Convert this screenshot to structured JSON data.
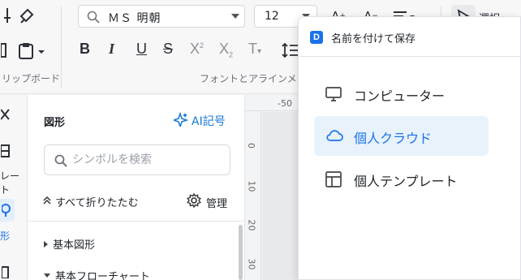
{
  "toolbar": {
    "clipboard_group_label": "リップボード",
    "font_group_label": "フォントとアラインメント",
    "font_family_value": "ＭＳ 明朝",
    "font_size_value": "12",
    "select_label": "選択",
    "format_buttons": [
      "B",
      "I",
      "U",
      "S",
      "X²",
      "X₂",
      "T"
    ]
  },
  "rail": {
    "items": [
      {
        "label": "レート",
        "icon": "template-icon"
      },
      {
        "label": "形",
        "icon": "shapes-icon"
      }
    ]
  },
  "shapes_panel": {
    "title": "図形",
    "ai_label": "AI記号",
    "search_placeholder": "シンボルを検索",
    "collapse_all_label": "すべて折りたたむ",
    "manage_label": "管理",
    "tree": [
      {
        "label": "基本図形",
        "expanded": false
      },
      {
        "label": "基本フローチャート",
        "expanded": true
      }
    ]
  },
  "ruler": {
    "top_numbers": [
      "-50"
    ],
    "left_numbers": [
      "0",
      "10",
      "20",
      "30"
    ]
  },
  "save_menu": {
    "title": "名前を付けて保存",
    "logo_letter": "D",
    "items": [
      {
        "label": "コンピューター",
        "icon": "monitor-icon",
        "selected": false
      },
      {
        "label": "個人クラウド",
        "icon": "cloud-icon",
        "selected": true
      },
      {
        "label": "個人テンプレート",
        "icon": "template-layout-icon",
        "selected": false
      }
    ],
    "accent_color": "#1a73e8"
  }
}
